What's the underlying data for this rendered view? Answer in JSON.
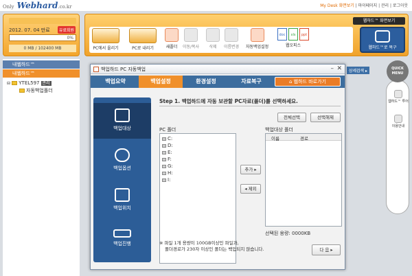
{
  "logo": {
    "brand": "Webhard",
    "suffix": ".co.kr",
    "tag": "Only"
  },
  "top_links": {
    "mydesk": "My Desk 화면보기",
    "rest": "| 마이페이지 | 관리 | 로그아웃"
  },
  "account": {
    "date": "2012. 07. 04 만료",
    "badge": "유료회원",
    "usage_percent": 0,
    "usage_percent_label": "0%",
    "usage_text": "0 MB / 102400 MB"
  },
  "toolbar": {
    "screen_label": "웹하드™ 화면보기",
    "buttons": [
      {
        "label": "PC에서 올리기"
      },
      {
        "label": "PC로 내리기"
      },
      {
        "label": "새폴더"
      },
      {
        "label": "이동/복사"
      },
      {
        "label": "삭제"
      },
      {
        "label": "이름변경"
      },
      {
        "label": "자동백업설정"
      },
      {
        "label": "웹오피스"
      }
    ],
    "restore_label": "웹하드™로 복구"
  },
  "tree": {
    "mine": "내웹하드™",
    "mine2": "내웹하드™",
    "node": "YTEL597",
    "node_tag": "관리",
    "child": "자동백업폴더"
  },
  "behind_title": "상세검색 ▸",
  "quick": {
    "menu_top": "QUICK",
    "menu_bottom": "MENU",
    "items": [
      {
        "label": "웹하드™ 투어"
      },
      {
        "label": "이용안내"
      }
    ]
  },
  "window": {
    "title": "백업하드 PC 자동백업",
    "tabs": [
      "백업요약",
      "백업설정",
      "환경설정",
      "자료복구"
    ],
    "goto": "웹하드 바로가기",
    "nav": [
      {
        "label": "백업대상"
      },
      {
        "label": "백업옵션"
      },
      {
        "label": "백업위치"
      },
      {
        "label": "백업진행"
      }
    ],
    "step": "Step 1. 백업하드에 자동 보관할 PC자료(폴더)를 선택하세요.",
    "select_all": "전체선택",
    "deselect": "선택해제",
    "pc_folder_label": "PC 폴더",
    "drives": [
      "C:",
      "D:",
      "E:",
      "F:",
      "G:",
      "H:",
      "I:"
    ],
    "add_label": "추가 ▸",
    "remove_label": "◂ 제외",
    "target_label": "백업대상 폴더",
    "target_columns": [
      "이름",
      "경로"
    ],
    "selected_size": "선택된 용량: 0000KB",
    "notes": [
      "※ 파일 1개 용량이 100GB이상인 파일과,",
      "폴더경로가 230자 이상인 폴더는 백업되지 않습니다."
    ],
    "next": "다 음 ▸"
  }
}
